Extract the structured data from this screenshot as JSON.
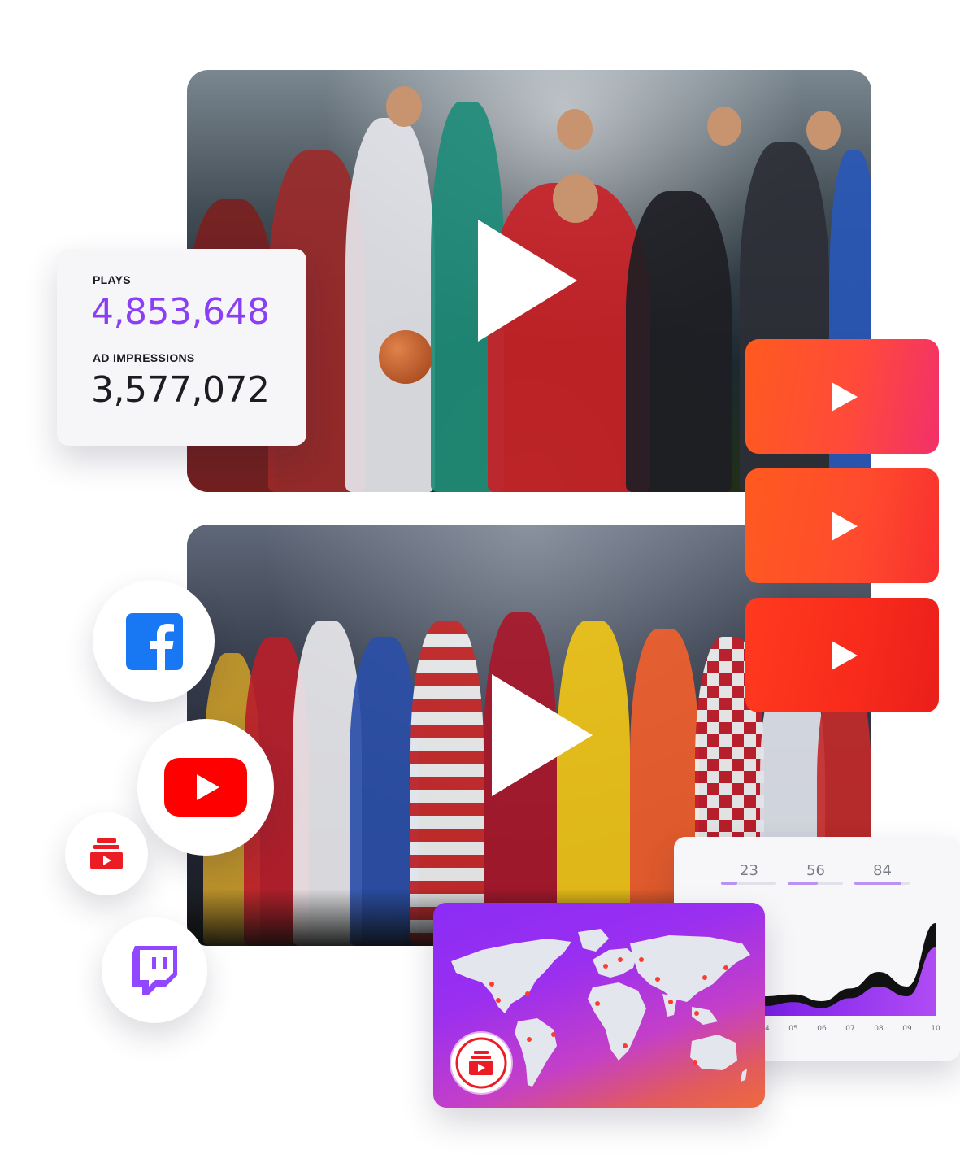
{
  "stats": {
    "plays_label": "PLAYS",
    "plays_value": "4,853,648",
    "ad_impressions_label": "AD IMPRESSIONS",
    "ad_impressions_value": "3,577,072"
  },
  "videos": [
    {
      "name": "multi-sport-athletes-video",
      "icon": "play-icon"
    },
    {
      "name": "soccer-players-lineup-video",
      "icon": "play-icon"
    }
  ],
  "play_tiles": [
    {
      "icon": "play-icon",
      "color": "#ff5a1f"
    },
    {
      "icon": "play-icon",
      "color": "#ff4a2e"
    },
    {
      "icon": "play-icon",
      "color": "#f82a1c"
    }
  ],
  "social_icons": [
    "facebook-icon",
    "youtube-icon",
    "streaming-stack-icon",
    "twitch-icon"
  ],
  "metrics": [
    {
      "value": "23",
      "fraction": 0.3
    },
    {
      "value": "56",
      "fraction": 0.55
    },
    {
      "value": "84",
      "fraction": 0.85
    }
  ],
  "chart_data": {
    "type": "area",
    "x": [
      "04",
      "05",
      "06",
      "07",
      "08",
      "09",
      "10"
    ],
    "series": [
      {
        "values": [
          20,
          22,
          15,
          28,
          45,
          30,
          95
        ]
      },
      {
        "values": [
          10,
          14,
          8,
          18,
          30,
          20,
          70
        ]
      }
    ],
    "ylim": [
      0,
      100
    ],
    "grid": false,
    "colors": [
      "#111111",
      "#9b37f0"
    ]
  },
  "map": {
    "badge_icon": "streaming-stack-icon",
    "gradient_start": "#8b2cf5",
    "gradient_end": "#ef6a3b"
  }
}
